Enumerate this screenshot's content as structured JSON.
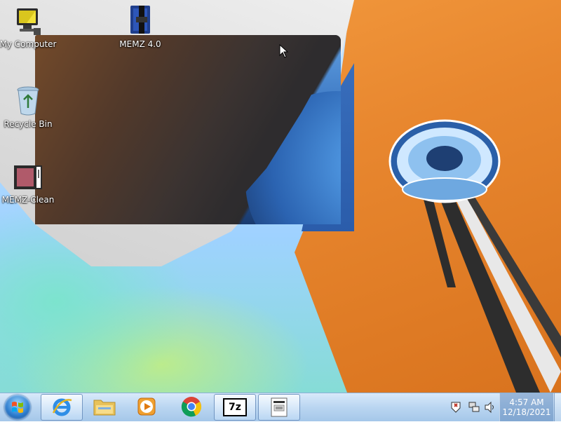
{
  "desktop": {
    "icons": [
      {
        "label": "My Computer",
        "icon": "computer-icon"
      },
      {
        "label": "MEMZ 4.0",
        "icon": "winrar-archive-icon"
      },
      {
        "label": "Recycle Bin",
        "icon": "recycle-bin-icon"
      },
      {
        "label": "MEMZ-Clean",
        "icon": "memz-clean-icon"
      }
    ]
  },
  "taskbar": {
    "start": {
      "icon": "windows-start-orb"
    },
    "buttons": [
      {
        "icon": "internet-explorer-icon"
      },
      {
        "icon": "file-explorer-icon"
      },
      {
        "icon": "media-player-icon"
      },
      {
        "icon": "chrome-icon"
      },
      {
        "icon": "7zip-icon",
        "text": "7z"
      },
      {
        "icon": "document-icon"
      }
    ],
    "tray": {
      "icons": [
        "action-center-icon",
        "network-icon",
        "volume-icon"
      ],
      "time": "4:57 AM",
      "date": "12/18/2021"
    }
  },
  "colors": {
    "sky": "#9fd2ff",
    "orange": "#e8872f",
    "taskbar": "#b4d2f0"
  }
}
